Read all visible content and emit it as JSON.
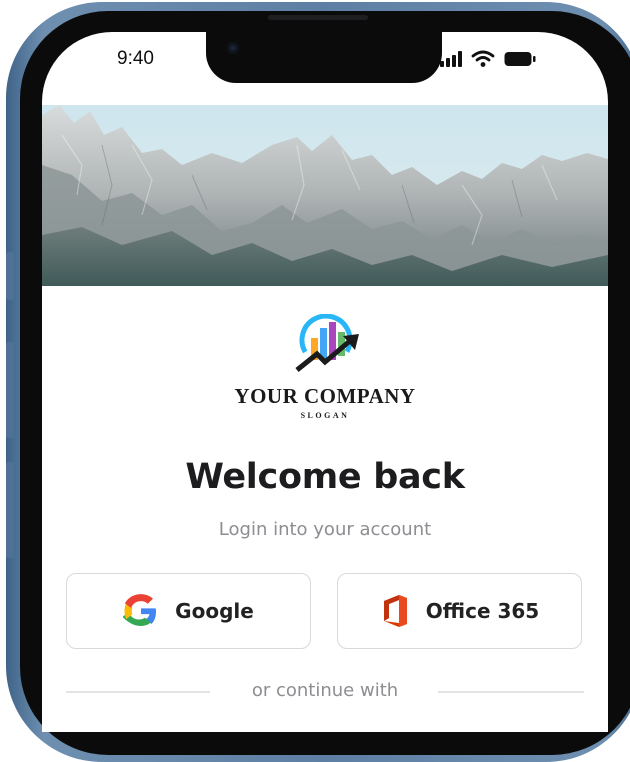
{
  "status_bar": {
    "time": "9:40"
  },
  "company": {
    "name": "YOUR COMPANY",
    "slogan": "SLOGAN"
  },
  "login": {
    "title": "Welcome back",
    "subtitle": "Login into your account",
    "google_label": "Google",
    "office_label": "Office 365",
    "divider_text": "or continue with"
  },
  "icons": {
    "status": [
      "cellular-signal-icon",
      "wifi-icon",
      "battery-icon"
    ],
    "google": "google-logo-icon",
    "office": "office-365-logo-icon",
    "logo": "company-logo-icon"
  },
  "colors": {
    "frame": "#5d7fa3",
    "title": "#1d1d1f",
    "muted": "#8d8d92",
    "border": "#d9d9dd"
  }
}
